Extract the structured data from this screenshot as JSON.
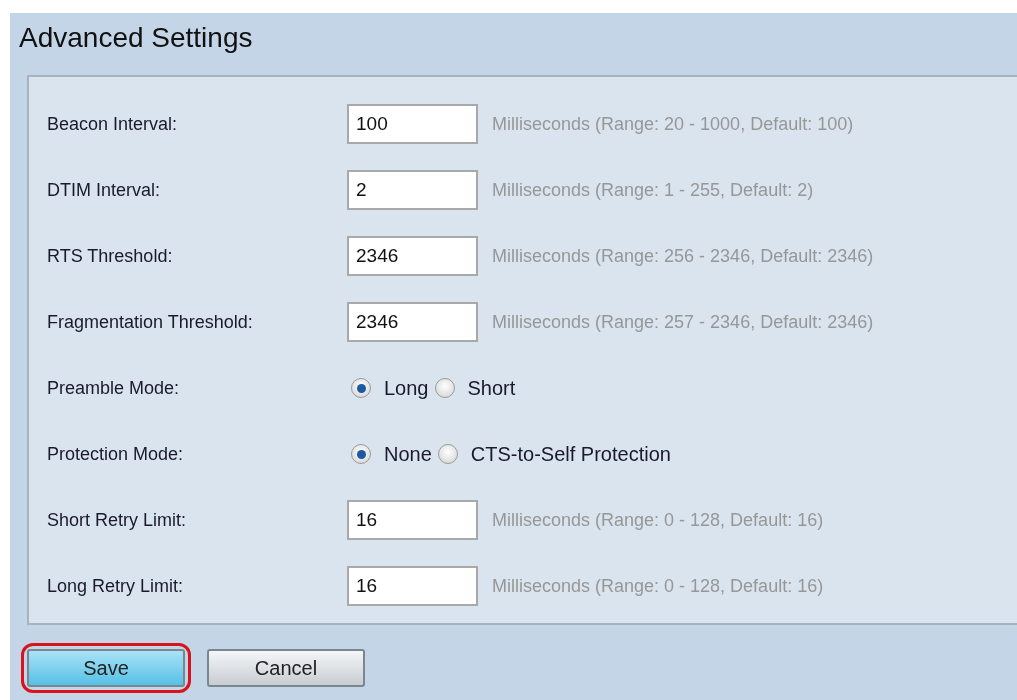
{
  "title": "Advanced Settings",
  "rows": [
    {
      "kind": "text",
      "label": "Beacon Interval:",
      "value": "100",
      "hint": "Milliseconds (Range: 20 - 1000, Default: 100)"
    },
    {
      "kind": "text",
      "label": "DTIM Interval:",
      "value": "2",
      "hint": "Milliseconds (Range: 1 - 255, Default: 2)"
    },
    {
      "kind": "text",
      "label": "RTS Threshold:",
      "value": "2346",
      "hint": "Milliseconds (Range: 256 - 2346, Default: 2346)"
    },
    {
      "kind": "text",
      "label": "Fragmentation Threshold:",
      "value": "2346",
      "hint": "Milliseconds (Range: 257 - 2346, Default: 2346)"
    },
    {
      "kind": "radio",
      "label": "Preamble Mode:",
      "options": [
        {
          "label": "Long",
          "selected": true
        },
        {
          "label": "Short",
          "selected": false
        }
      ]
    },
    {
      "kind": "radio",
      "label": "Protection Mode:",
      "options": [
        {
          "label": "None",
          "selected": true
        },
        {
          "label": "CTS-to-Self Protection",
          "selected": false
        }
      ]
    },
    {
      "kind": "text",
      "label": "Short Retry Limit:",
      "value": "16",
      "hint": "Milliseconds (Range: 0 - 128, Default: 16)"
    },
    {
      "kind": "text",
      "label": "Long Retry Limit:",
      "value": "16",
      "hint": "Milliseconds (Range: 0 - 128, Default: 16)"
    }
  ],
  "buttons": [
    {
      "label": "Save",
      "kind": "primary",
      "highlighted": true
    },
    {
      "label": "Cancel",
      "kind": "secondary",
      "highlighted": false
    }
  ]
}
